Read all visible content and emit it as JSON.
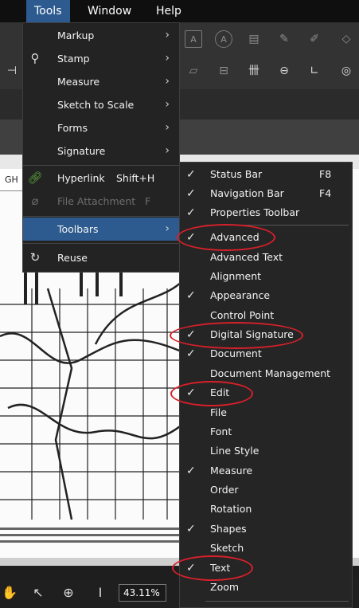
{
  "menubar": {
    "tools": "Tools",
    "window": "Window",
    "help": "Help"
  },
  "tools_menu": {
    "items": [
      {
        "label": "Markup",
        "icon": "",
        "arrow": "›"
      },
      {
        "label": "Stamp",
        "icon": "stamp-icon",
        "arrow": "›"
      },
      {
        "label": "Measure",
        "icon": "",
        "arrow": "›"
      },
      {
        "label": "Sketch to Scale",
        "icon": "",
        "arrow": "›"
      },
      {
        "label": "Forms",
        "icon": "",
        "arrow": "›"
      },
      {
        "label": "Signature",
        "icon": "",
        "arrow": "›"
      },
      {
        "label": "Hyperlink",
        "shortcut": "Shift+H",
        "icon": "link-icon"
      },
      {
        "label": "File Attachment",
        "shortcut": "F",
        "icon": "paperclip-icon",
        "disabled": true
      },
      {
        "label": "Toolbars",
        "icon": "",
        "arrow": "›",
        "highlighted": true
      },
      {
        "label": "Reuse",
        "icon": "reuse-icon"
      }
    ]
  },
  "toolbars_submenu": {
    "items": [
      {
        "label": "Status Bar",
        "shortcut": "F8",
        "checked": true
      },
      {
        "label": "Navigation Bar",
        "shortcut": "F4",
        "checked": true
      },
      {
        "label": "Properties Toolbar",
        "checked": true
      },
      {
        "label": "Advanced",
        "checked": true
      },
      {
        "label": "Advanced Text",
        "checked": false
      },
      {
        "label": "Alignment",
        "checked": false
      },
      {
        "label": "Appearance",
        "checked": true
      },
      {
        "label": "Control Point",
        "checked": false
      },
      {
        "label": "Digital Signature",
        "checked": true
      },
      {
        "label": "Document",
        "checked": true
      },
      {
        "label": "Document Management",
        "checked": false
      },
      {
        "label": "Edit",
        "checked": true
      },
      {
        "label": "File",
        "checked": false
      },
      {
        "label": "Font",
        "checked": false
      },
      {
        "label": "Line Style",
        "checked": false
      },
      {
        "label": "Measure",
        "checked": true
      },
      {
        "label": "Order",
        "checked": false
      },
      {
        "label": "Rotation",
        "checked": false
      },
      {
        "label": "Shapes",
        "checked": true
      },
      {
        "label": "Sketch",
        "checked": false
      },
      {
        "label": "Text",
        "checked": true
      },
      {
        "label": "Zoom",
        "checked": false
      }
    ],
    "check_glyph": "✓"
  },
  "doc": {
    "tab_label": "GH"
  },
  "bottombar": {
    "zoom_value": "43.11%"
  },
  "colors": {
    "highlight": "#2d5b8f",
    "annotation": "#d6202a"
  }
}
